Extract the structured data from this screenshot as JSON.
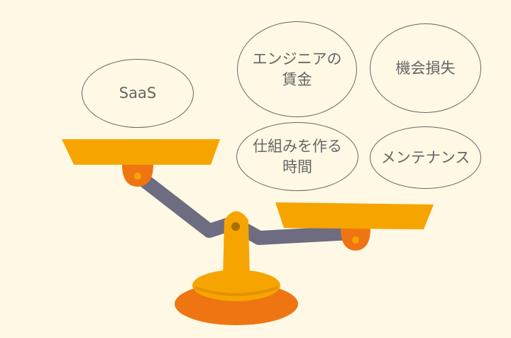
{
  "bubbles": {
    "saas": "SaaS",
    "engineer_wage_1": "エンジニアの",
    "engineer_wage_2": "賃金",
    "opportunity_loss": "機会損失",
    "build_time_1": "仕組みを作る",
    "build_time_2": "時間",
    "maintenance": "メンテナンス"
  },
  "colors": {
    "background": "#fef8e4",
    "pan": "#f6a400",
    "hub": "#ee7512",
    "beam": "#6e6c80",
    "text": "#666666"
  }
}
